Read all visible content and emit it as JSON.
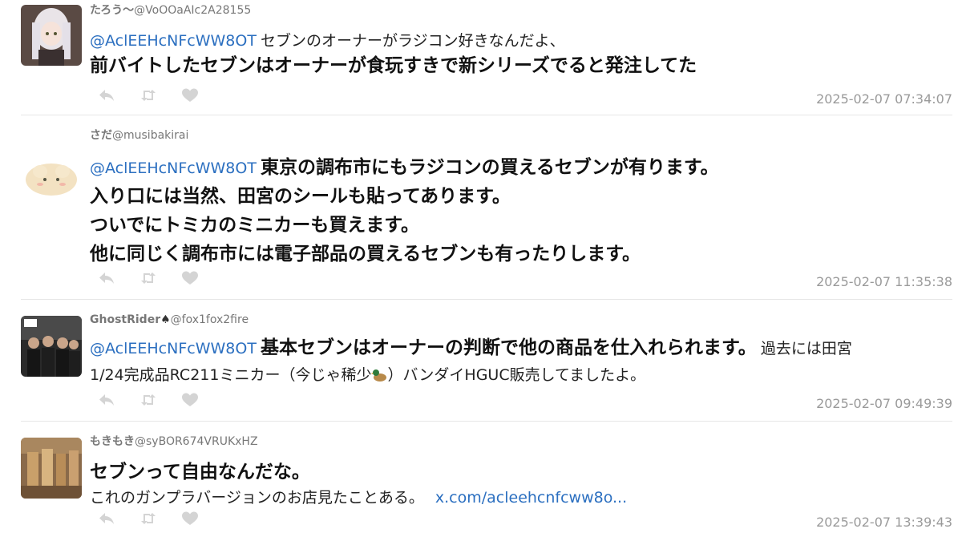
{
  "icons": {
    "reply": "reply-icon",
    "retweet": "retweet-icon",
    "like": "heart-icon"
  },
  "colors": {
    "mention": "#2b6fc0",
    "muted": "#9a9a9a",
    "icon": "#d4d4d4"
  },
  "tweets": [
    {
      "name": "たろう～",
      "handle": "@VoOOaAIc2A28155",
      "mention": "@AclEEHcNFcWW8OT",
      "small_text": "セブンのオーナーがラジコン好きなんだよ、",
      "big_text": "前バイトしたセブンはオーナーが食玩すきで新シリーズでると発注してた",
      "timestamp": "2025-02-07 07:34:07"
    },
    {
      "name": "さだ",
      "handle": "@musibakirai",
      "mention": "@AclEEHcNFcWW8OT",
      "big_line1": "東京の調布市にもラジコンの買えるセブンが有ります。",
      "big_line2": "入り口には当然、田宮のシールも貼ってあります。",
      "big_line3": "ついでにトミカのミニカーも買えます。",
      "big_line4": "他に同じく調布市には電子部品の買えるセブンも有ったりします。",
      "timestamp": "2025-02-07 11:35:38"
    },
    {
      "name": "GhostRider",
      "name_symbol": "♠",
      "handle": "@fox1fox2fire",
      "mention": "@AclEEHcNFcWW8OT",
      "big_text": "基本セブンはオーナーの判断で他の商品を仕入れられます。",
      "small_text_1": "過去には田宮",
      "small_text_2a": "1/24完成品RC211ミニカー（今じゃ稀少",
      "small_text_2b": "）バンダイHGUC販売してましたよ。",
      "timestamp": "2025-02-07 09:49:39"
    },
    {
      "name": "もきもき",
      "handle": "@syBOR674VRUKxHZ",
      "big_text": "セブンって自由なんだな。",
      "small_text": "これのガンプラバージョンのお店見たことある。",
      "link_text": "x.com/acleehcnfcww8o...",
      "timestamp": "2025-02-07 13:39:43"
    }
  ]
}
